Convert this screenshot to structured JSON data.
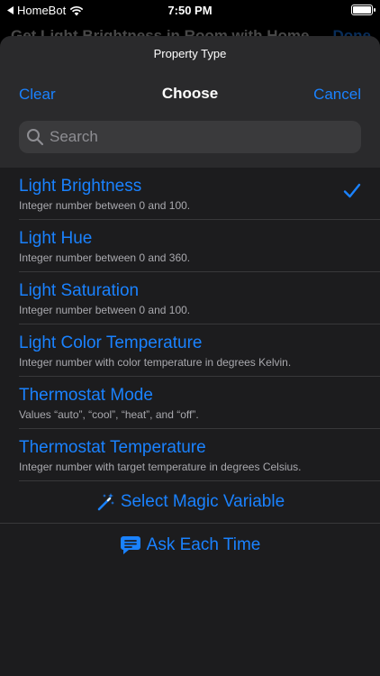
{
  "status_bar": {
    "back_app": "HomeBot",
    "time": "7:50 PM"
  },
  "background_nav": {
    "title": "Get Light Brightness in Room with Home",
    "done": "Done"
  },
  "sheet": {
    "property_type_label": "Property Type",
    "nav": {
      "clear": "Clear",
      "title": "Choose",
      "cancel": "Cancel"
    },
    "search": {
      "placeholder": "Search",
      "value": ""
    },
    "items": [
      {
        "title": "Light Brightness",
        "subtitle": "Integer number between 0 and 100.",
        "selected": true
      },
      {
        "title": "Light Hue",
        "subtitle": "Integer number between 0 and 360.",
        "selected": false
      },
      {
        "title": "Light Saturation",
        "subtitle": "Integer number between 0 and 100.",
        "selected": false
      },
      {
        "title": "Light Color Temperature",
        "subtitle": "Integer number with color temperature in degrees Kelvin.",
        "selected": false
      },
      {
        "title": "Thermostat Mode",
        "subtitle": "Values “auto”, “cool”, “heat”, and “off”.",
        "selected": false
      },
      {
        "title": "Thermostat Temperature",
        "subtitle": "Integer number with target temperature in degrees Celsius.",
        "selected": false
      }
    ],
    "actions": {
      "magic_variable": {
        "label": "Select Magic Variable",
        "icon": "magic-wand-icon"
      },
      "ask_each_time": {
        "label": "Ask Each Time",
        "icon": "speech-bubble-icon"
      }
    }
  },
  "colors": {
    "accent": "#1a82ff",
    "sheet_bg": "#1c1c1e",
    "header_bg": "#2a2a2c",
    "search_bg": "#3a3a3c",
    "subtitle": "#a9a9ae"
  }
}
